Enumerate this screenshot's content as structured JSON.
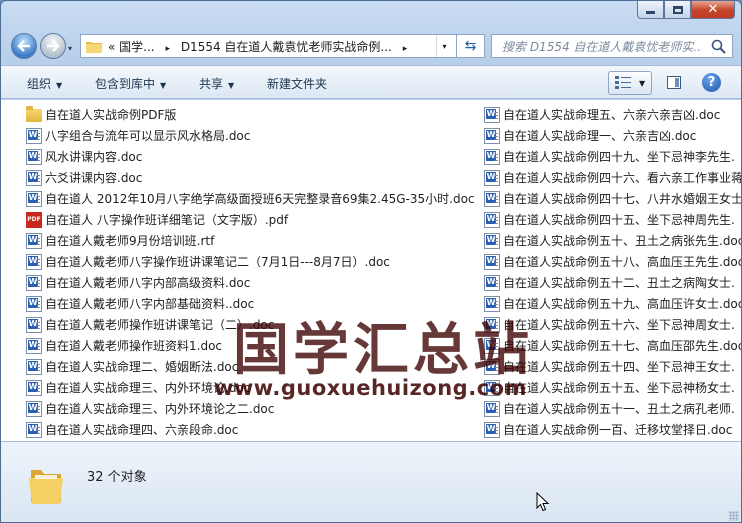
{
  "window": {
    "caption_buttons": [
      "minimize",
      "maximize",
      "close"
    ],
    "close_glyph": "✕"
  },
  "address": {
    "chevron": "«",
    "crumbs": [
      "国学...",
      "D1554 自在道人戴袁忧老师实战命例..."
    ],
    "separator": "▸",
    "dropdown": "▾",
    "refresh": "⇆"
  },
  "search": {
    "placeholder": "搜索 D1554 自在道人戴袁忧老师实..."
  },
  "toolbar": {
    "organize": "组织",
    "include_in_library": "包含到库中",
    "share": "共享",
    "new_folder": "新建文件夹",
    "dropdown_arrow": "▼",
    "help": "?"
  },
  "files_left": [
    {
      "name": "自在道人实战命例PDF版",
      "type": "folder"
    },
    {
      "name": "八字组合与流年可以显示风水格局.doc",
      "type": "doc"
    },
    {
      "name": "风水讲课内容.doc",
      "type": "doc"
    },
    {
      "name": "六爻讲课内容.doc",
      "type": "doc"
    },
    {
      "name": "自在道人 2012年10月八字绝学高级面授班6天完整录音69集2.45G-35小时.doc",
      "type": "doc"
    },
    {
      "name": "自在道人 八字操作班详细笔记（文字版）.pdf",
      "type": "pdf"
    },
    {
      "name": "自在道人戴老师9月份培训班.rtf",
      "type": "doc"
    },
    {
      "name": "自在道人戴老师八字操作班讲课笔记二（7月1日---8月7日）.doc",
      "type": "doc"
    },
    {
      "name": "自在道人戴老师八字内部高级资料.doc",
      "type": "doc"
    },
    {
      "name": "自在道人戴老师八字内部基础资料..doc",
      "type": "doc"
    },
    {
      "name": "自在道人戴老师操作班讲课笔记（二）.doc",
      "type": "doc"
    },
    {
      "name": "自在道人戴老师操作班资料1.doc",
      "type": "doc"
    },
    {
      "name": "自在道人实战命理二、婚姻断法.doc",
      "type": "doc"
    },
    {
      "name": "自在道人实战命理三、内外环境论.doc",
      "type": "doc"
    },
    {
      "name": "自在道人实战命理三、内外环境论之二.doc",
      "type": "doc"
    },
    {
      "name": "自在道人实战命理四、六亲段命.doc",
      "type": "doc"
    }
  ],
  "files_right": [
    {
      "name": "自在道人实战命理五、六亲六亲吉凶.doc",
      "type": "doc"
    },
    {
      "name": "自在道人实战命理一、六亲吉凶.doc",
      "type": "doc"
    },
    {
      "name": "自在道人实战命例四十九、坐下忌神李先生.",
      "type": "doc"
    },
    {
      "name": "自在道人实战命例四十六、看六亲工作事业蒋",
      "type": "doc"
    },
    {
      "name": "自在道人实战命例四十七、八井水婚姻王女士",
      "type": "doc"
    },
    {
      "name": "自在道人实战命例四十五、坐下忌神周先生.",
      "type": "doc"
    },
    {
      "name": "自在道人实战命例五十、丑土之病张先生.doc",
      "type": "doc"
    },
    {
      "name": "自在道人实战命例五十八、高血压王先生.doc",
      "type": "doc"
    },
    {
      "name": "自在道人实战命例五十二、丑土之病陶女士.",
      "type": "doc"
    },
    {
      "name": "自在道人实战命例五十九、高血压许女士.doc",
      "type": "doc"
    },
    {
      "name": "自在道人实战命例五十六、坐下忌神周女士.",
      "type": "doc"
    },
    {
      "name": "自在道人实战命例五十七、高血压邵先生.doc",
      "type": "doc"
    },
    {
      "name": "自在道人实战命例五十四、坐下忌神王女士.",
      "type": "doc"
    },
    {
      "name": "自在道人实战命例五十五、坐下忌神杨女士.",
      "type": "doc"
    },
    {
      "name": "自在道人实战命例五十一、丑土之病孔老师.",
      "type": "doc"
    },
    {
      "name": "自在道人实战命例一百、迁移坟堂择日.doc",
      "type": "doc"
    }
  ],
  "watermark": {
    "title": "国学汇总站",
    "url": "www.guoxuehuizong.com"
  },
  "status": {
    "count": "32 个对象"
  },
  "colors": {
    "accent": "#3c7cc7",
    "window_frame": "#b7cfea",
    "close": "#c4432b"
  }
}
